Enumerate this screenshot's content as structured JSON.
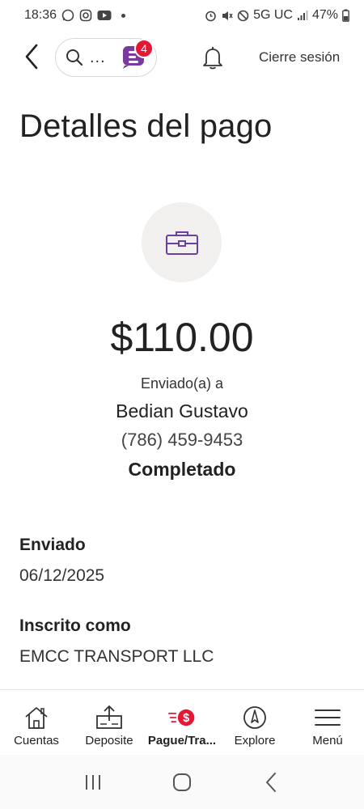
{
  "status_bar": {
    "time": "18:36",
    "network": "5G UC",
    "battery": "47%"
  },
  "header": {
    "search_dots": "...",
    "erica_badge_count": "4",
    "logout_label": "Cierre sesión"
  },
  "page": {
    "title": "Detalles del pago"
  },
  "payment": {
    "icon": "briefcase-icon",
    "amount": "$110.00",
    "sent_to_label": "Enviado(a) a",
    "recipient_name": "Bedian Gustavo",
    "recipient_phone": "(786) 459-9453",
    "status": "Completado"
  },
  "details": {
    "sent_label": "Enviado",
    "sent_date": "06/12/2025",
    "enrolled_label": "Inscrito como",
    "enrolled_value": "EMCC TRANSPORT LLC"
  },
  "bottom_nav": {
    "items": [
      {
        "label": "Cuentas",
        "icon": "home-icon"
      },
      {
        "label": "Deposite",
        "icon": "deposit-icon"
      },
      {
        "label": "Pague/Tra...",
        "icon": "pay-transfer-icon",
        "active": true
      },
      {
        "label": "Explore",
        "icon": "compass-icon"
      },
      {
        "label": "Menú",
        "icon": "menu-icon"
      }
    ]
  },
  "colors": {
    "accent_red": "#e31837",
    "purple": "#6b3fa0",
    "icon_circle_bg": "#f2f0ee"
  }
}
